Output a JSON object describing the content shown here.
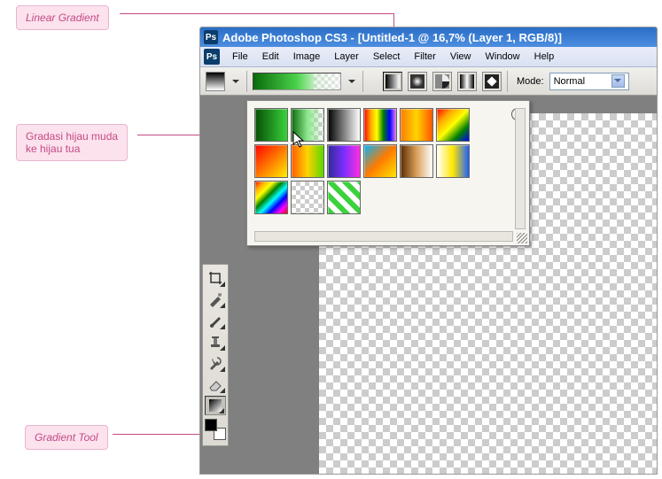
{
  "annotations": {
    "linear_gradient": "Linear Gradient",
    "gradasi": "Gradasi hijau muda\nke hijau tua",
    "gradient_tool": "Gradient Tool"
  },
  "title": {
    "app": "Adobe Photoshop CS3 -",
    "doc": "[Untitled-1 @ 16,7% (Layer 1, RGB/8)]"
  },
  "menu": {
    "file": "File",
    "edit": "Edit",
    "image": "Image",
    "layer": "Layer",
    "select": "Select",
    "filter": "Filter",
    "view": "View",
    "window": "Window",
    "help": "Help"
  },
  "options": {
    "mode_label": "Mode:",
    "mode_value": "Normal"
  },
  "picker": {
    "swatches": [
      "linear-gradient(to right,#064f06,#3bd23b)",
      "linear-gradient(to right,#0a6b0a,#8ee78e,rgba(255,255,255,0))",
      "linear-gradient(to right,#000,#fff)",
      "linear-gradient(to right,red,orange,yellow,green,blue,violet)",
      "linear-gradient(to right,#ff7a00,#ffd400,#ff5500)",
      "linear-gradient(135deg,red,orange,yellow,green,blue)",
      "linear-gradient(135deg,#ff0000,#ffee00)",
      "linear-gradient(to right,#ff5a00,#ffd400,#5bd600)",
      "linear-gradient(to right,#2e2b8f,#7a2eff,#ff2ee0)",
      "linear-gradient(135deg,#00b3ff,#ff7a00,#ffe600)",
      "linear-gradient(to right,#5a2b00,#d9a05a,#fff)",
      "linear-gradient(to right,#fff,#ffe600,#1e5fff)",
      "linear-gradient(135deg,red,orange,yellow,green,cyan,blue,magenta,red)",
      "repeating-conic-gradient(#ccc 0 25%, #fff 0 50%) 0 0/10px 10px",
      "repeating-linear-gradient(45deg,#3bd23b 0 6px, #fff 6px 12px)"
    ]
  }
}
